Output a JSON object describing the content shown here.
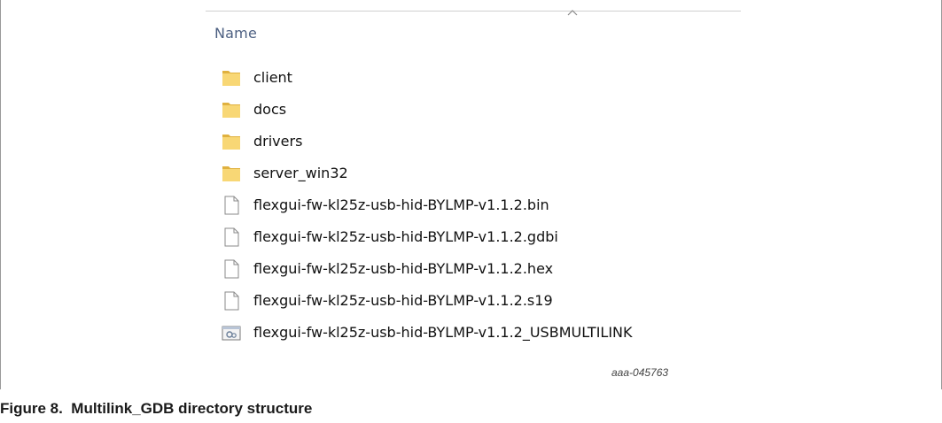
{
  "explorer": {
    "column_header": "Name",
    "sort_icon": "chevron-up-icon",
    "items": [
      {
        "name": "client",
        "type": "folder",
        "icon": "folder-icon"
      },
      {
        "name": "docs",
        "type": "folder",
        "icon": "folder-icon"
      },
      {
        "name": "drivers",
        "type": "folder",
        "icon": "folder-icon"
      },
      {
        "name": "server_win32",
        "type": "folder",
        "icon": "folder-icon"
      },
      {
        "name": "flexgui-fw-kl25z-usb-hid-BYLMP-v1.1.2.bin",
        "type": "file",
        "icon": "file-icon"
      },
      {
        "name": "flexgui-fw-kl25z-usb-hid-BYLMP-v1.1.2.gdbi",
        "type": "file",
        "icon": "file-icon"
      },
      {
        "name": "flexgui-fw-kl25z-usb-hid-BYLMP-v1.1.2.hex",
        "type": "file",
        "icon": "file-icon"
      },
      {
        "name": "flexgui-fw-kl25z-usb-hid-BYLMP-v1.1.2.s19",
        "type": "file",
        "icon": "file-icon"
      },
      {
        "name": "flexgui-fw-kl25z-usb-hid-BYLMP-v1.1.2_USBMULTILINK",
        "type": "config",
        "icon": "settings-file-icon"
      }
    ]
  },
  "figure_id": "aaa-045763",
  "caption": "Figure 8.  Multilink_GDB directory structure",
  "colors": {
    "folder": "#f8d775",
    "folder_shadow": "#e0b13f",
    "header_text": "#4d6082",
    "border": "#9a9a9a"
  }
}
